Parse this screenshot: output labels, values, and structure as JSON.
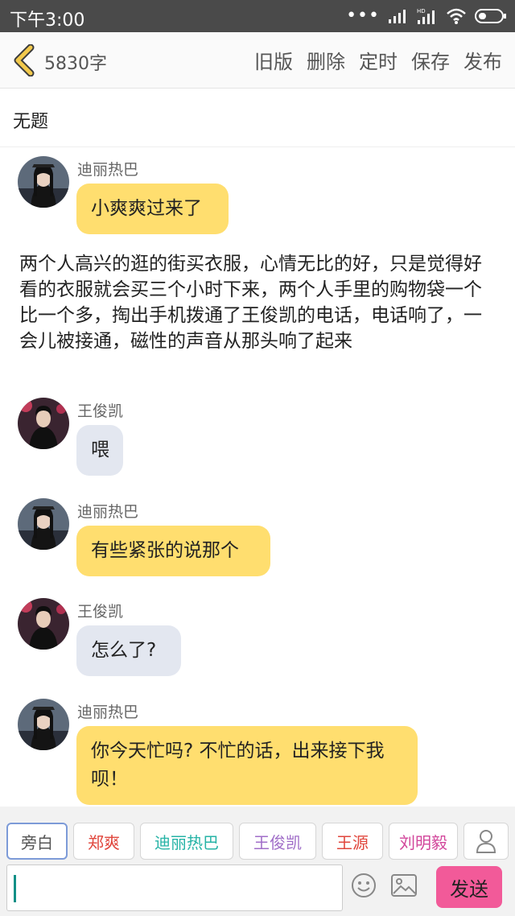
{
  "status_bar": {
    "time": "下午3:00"
  },
  "toolbar": {
    "word_count": "5830字",
    "actions": [
      "旧版",
      "删除",
      "定时",
      "保存",
      "发布"
    ]
  },
  "title": "无题",
  "messages": [
    {
      "speaker": "迪丽热巴",
      "avatar_icon": "avatar-dilireba",
      "text": "小爽爽过来了",
      "bubble_color": "#ffde6f"
    },
    {
      "speaker": "王俊凯",
      "avatar_icon": "avatar-wangjunkai",
      "text": "喂",
      "bubble_color": "#e3e7f0"
    },
    {
      "speaker": "迪丽热巴",
      "avatar_icon": "avatar-dilireba",
      "text": "有些紧张的说那个",
      "bubble_color": "#ffde6f"
    },
    {
      "speaker": "王俊凯",
      "avatar_icon": "avatar-wangjunkai",
      "text": "怎么了?",
      "bubble_color": "#e3e7f0"
    },
    {
      "speaker": "迪丽热巴",
      "avatar_icon": "avatar-dilireba",
      "text": "你今天忙吗? 不忙的话，出来接下我呗！",
      "bubble_color": "#ffde6f"
    }
  ],
  "narration": "两个人高兴的逛的街买衣服，心情无比的好，只是觉得好看的衣服就会买三个小时下来，两个人手里的购物袋一个比一个多，掏出手机拨通了王俊凯的电话，电话响了，一会儿被接通，磁性的声音从那头响了起来",
  "roles": [
    {
      "label": "旁白",
      "color": "#555555",
      "selected": true
    },
    {
      "label": "郑爽",
      "color": "#e0463c",
      "selected": false
    },
    {
      "label": "迪丽热巴",
      "color": "#26b3a6",
      "selected": false
    },
    {
      "label": "王俊凯",
      "color": "#a06ec8",
      "selected": false
    },
    {
      "label": "王源",
      "color": "#e0463c",
      "selected": false
    },
    {
      "label": "刘明毅",
      "color": "#d2469b",
      "selected": false
    }
  ],
  "composer": {
    "input_value": "",
    "send_label": "发送"
  },
  "colors": {
    "accent_send": "#f25a99",
    "back_arrow": "#f2c94c",
    "yellow_bubble": "#ffde6f",
    "gray_bubble": "#e3e7f0"
  }
}
